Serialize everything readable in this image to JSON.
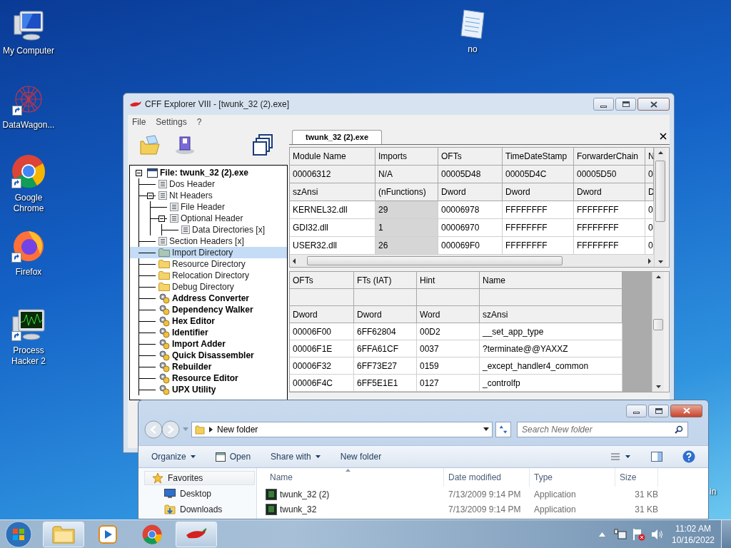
{
  "desktop_icons": [
    {
      "label": "My Computer",
      "kind": "computer",
      "shortcut": false
    },
    {
      "label": "DataWagon...",
      "kind": "datawagon",
      "shortcut": true
    },
    {
      "label": "Google Chrome",
      "kind": "chrome",
      "shortcut": true
    },
    {
      "label": "Firefox",
      "kind": "firefox",
      "shortcut": true
    },
    {
      "label": "Process Hacker 2",
      "kind": "processhacker",
      "shortcut": true
    },
    {
      "label": "no",
      "kind": "notepad",
      "shortcut": false
    },
    {
      "label": "in",
      "kind": "partial"
    }
  ],
  "cff_window": {
    "title": "CFF Explorer VIII - [twunk_32 (2).exe]",
    "menu": [
      "File",
      "Settings",
      "?"
    ],
    "tree": [
      {
        "label": "File: twunk_32 (2).exe",
        "kind": "file",
        "expanded": true,
        "selected": false,
        "children": [
          {
            "label": "Dos Header",
            "kind": "doc",
            "selected": false
          },
          {
            "label": "Nt Headers",
            "kind": "doc",
            "expanded": true,
            "selected": false,
            "children": [
              {
                "label": "File Header",
                "kind": "doc",
                "selected": false
              },
              {
                "label": "Optional Header",
                "kind": "doc",
                "expanded": true,
                "selected": false,
                "children": [
                  {
                    "label": "Data Directories [x]",
                    "kind": "doc",
                    "selected": false
                  }
                ]
              }
            ]
          },
          {
            "label": "Section Headers [x]",
            "kind": "doc",
            "selected": false
          },
          {
            "label": "Import Directory",
            "kind": "folder",
            "selected": true
          },
          {
            "label": "Resource Directory",
            "kind": "folder",
            "selected": false
          },
          {
            "label": "Relocation Directory",
            "kind": "folder",
            "selected": false
          },
          {
            "label": "Debug Directory",
            "kind": "folder",
            "selected": false
          },
          {
            "label": "Address Converter",
            "kind": "tool",
            "selected": false
          },
          {
            "label": "Dependency Walker",
            "kind": "tool",
            "selected": false
          },
          {
            "label": "Hex Editor",
            "kind": "tool",
            "selected": false
          },
          {
            "label": "Identifier",
            "kind": "tool",
            "selected": false
          },
          {
            "label": "Import Adder",
            "kind": "tool",
            "selected": false
          },
          {
            "label": "Quick Disassembler",
            "kind": "tool",
            "selected": false
          },
          {
            "label": "Rebuilder",
            "kind": "tool",
            "selected": false
          },
          {
            "label": "Resource Editor",
            "kind": "tool",
            "selected": false
          },
          {
            "label": "UPX Utility",
            "kind": "tool",
            "selected": false
          }
        ]
      }
    ],
    "tab": {
      "label": "twunk_32 (2).exe"
    },
    "modules_table": {
      "columns": [
        {
          "label": "Module Name",
          "shaded": false
        },
        {
          "label": "Imports",
          "shaded": true
        },
        {
          "label": "OFTs",
          "shaded": false
        },
        {
          "label": "TimeDateStamp",
          "shaded": false
        },
        {
          "label": "ForwarderChain",
          "shaded": false
        },
        {
          "label": "N",
          "shaded": false
        }
      ],
      "header_rows": [
        [
          "00006312",
          "N/A",
          "00005D48",
          "00005D4C",
          "00005D50",
          "0"
        ],
        [
          "szAnsi",
          "(nFunctions)",
          "Dword",
          "Dword",
          "Dword",
          "D"
        ]
      ],
      "rows": [
        [
          "KERNEL32.dll",
          "29",
          "00006978",
          "FFFFFFFF",
          "FFFFFFFF",
          "0"
        ],
        [
          "GDI32.dll",
          "1",
          "00006970",
          "FFFFFFFF",
          "FFFFFFFF",
          "0"
        ],
        [
          "USER32.dll",
          "26",
          "000069F0",
          "FFFFFFFF",
          "FFFFFFFF",
          "0"
        ]
      ]
    },
    "imports_table": {
      "columns": [
        "OFTs",
        "FTs (IAT)",
        "Hint",
        "Name"
      ],
      "header_rows": [
        [
          "Dword",
          "Dword",
          "Word",
          "szAnsi"
        ]
      ],
      "rows": [
        [
          "00006F00",
          "6FF62804",
          "00D2",
          "__set_app_type"
        ],
        [
          "00006F1E",
          "6FFA61CF",
          "0037",
          "?terminate@@YAXXZ"
        ],
        [
          "00006F32",
          "6FF73E27",
          "0159",
          "_except_handler4_common"
        ],
        [
          "00006F4C",
          "6FF5E1E1",
          "0127",
          "_controlfp"
        ]
      ]
    }
  },
  "explorer": {
    "address": "New folder",
    "search_placeholder": "Search New folder",
    "toolbar": [
      {
        "label": "Organize",
        "kind": "menu"
      },
      {
        "label": "Open",
        "kind": "open"
      },
      {
        "label": "Share with",
        "kind": "menu"
      },
      {
        "label": "New folder",
        "kind": "plain"
      }
    ],
    "nav": [
      {
        "label": "Favorites",
        "kind": "star"
      },
      {
        "label": "Desktop",
        "kind": "desktop"
      },
      {
        "label": "Downloads",
        "kind": "downloads"
      }
    ],
    "columns": [
      "Name",
      "Date modified",
      "Type",
      "Size"
    ],
    "files": [
      {
        "name": "twunk_32 (2)",
        "date": "7/13/2009 9:14 PM",
        "type": "Application",
        "size": "31 KB"
      },
      {
        "name": "twunk_32",
        "date": "7/13/2009 9:14 PM",
        "type": "Application",
        "size": "31 KB"
      }
    ]
  },
  "taskbar": {
    "apps": [
      {
        "kind": "explorer",
        "open": true
      },
      {
        "kind": "media",
        "open": false
      },
      {
        "kind": "chrome",
        "open": false
      },
      {
        "kind": "chili",
        "open": true
      }
    ],
    "time": "11:02 AM",
    "date": "10/16/2022"
  }
}
